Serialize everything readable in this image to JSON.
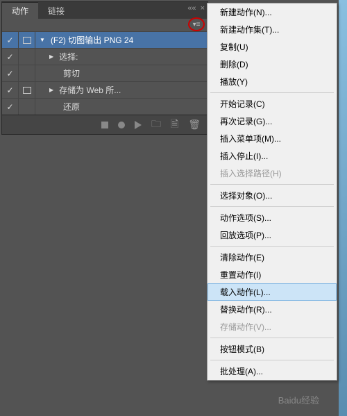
{
  "tabs": {
    "active": "动作",
    "inactive": "链接"
  },
  "action": {
    "title_prefix": "▼",
    "title": "(F2) 切图输出 PNG 24",
    "rows": [
      {
        "marker": "▶",
        "label": "选择:"
      },
      {
        "marker": "",
        "label": "剪切"
      },
      {
        "marker": "▶",
        "label": "存储为 Web 所..."
      },
      {
        "marker": "",
        "label": "还原"
      }
    ]
  },
  "menu": {
    "items": [
      {
        "label": "新建动作(N)...",
        "disabled": false
      },
      {
        "label": "新建动作集(T)...",
        "disabled": false
      },
      {
        "label": "复制(U)",
        "disabled": false
      },
      {
        "label": "删除(D)",
        "disabled": false
      },
      {
        "label": "播放(Y)",
        "disabled": false
      },
      {
        "sep": true
      },
      {
        "label": "开始记录(C)",
        "disabled": false
      },
      {
        "label": "再次记录(G)...",
        "disabled": false
      },
      {
        "label": "插入菜单项(M)...",
        "disabled": false
      },
      {
        "label": "插入停止(I)...",
        "disabled": false
      },
      {
        "label": "插入选择路径(H)",
        "disabled": true
      },
      {
        "sep": true
      },
      {
        "label": "选择对象(O)...",
        "disabled": false
      },
      {
        "sep": true
      },
      {
        "label": "动作选项(S)...",
        "disabled": false
      },
      {
        "label": "回放选项(P)...",
        "disabled": false
      },
      {
        "sep": true
      },
      {
        "label": "清除动作(E)",
        "disabled": false
      },
      {
        "label": "重置动作(I)",
        "disabled": false
      },
      {
        "label": "载入动作(L)...",
        "disabled": false,
        "hover": true
      },
      {
        "label": "替换动作(R)...",
        "disabled": false
      },
      {
        "label": "存储动作(V)...",
        "disabled": true
      },
      {
        "sep": true
      },
      {
        "label": "按钮模式(B)",
        "disabled": false
      },
      {
        "sep": true
      },
      {
        "label": "批处理(A)...",
        "disabled": false
      }
    ]
  },
  "watermark": "Baidu经验"
}
